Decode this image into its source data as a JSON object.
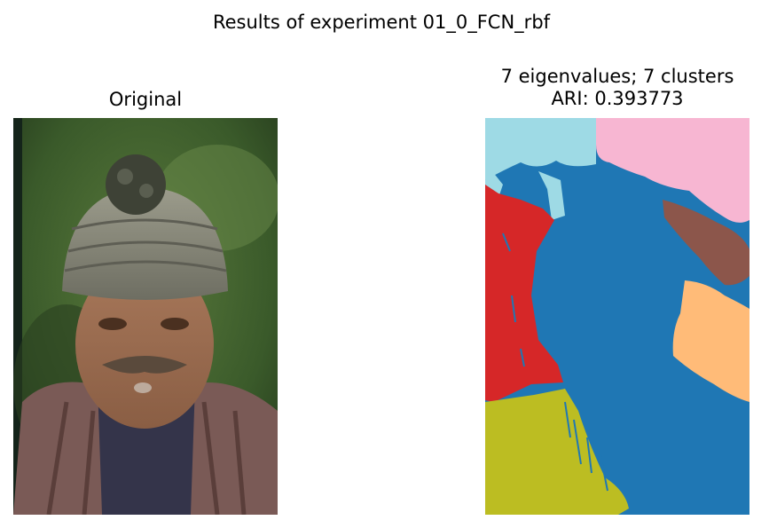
{
  "figure": {
    "suptitle": "Results of experiment 01_0_FCN_rbf"
  },
  "left_panel": {
    "title": "Original"
  },
  "right_panel": {
    "title_line1": "7 eigenvalues; 7 clusters",
    "title_line2": "ARI: 0.393773"
  },
  "segment_colors": {
    "main_blue": "#1f77b4",
    "light_cyan": "#9edae5",
    "pink": "#f7b6d2",
    "red": "#d62728",
    "brown": "#8c564b",
    "orange": "#ffbb78",
    "olive": "#bcbd22"
  }
}
